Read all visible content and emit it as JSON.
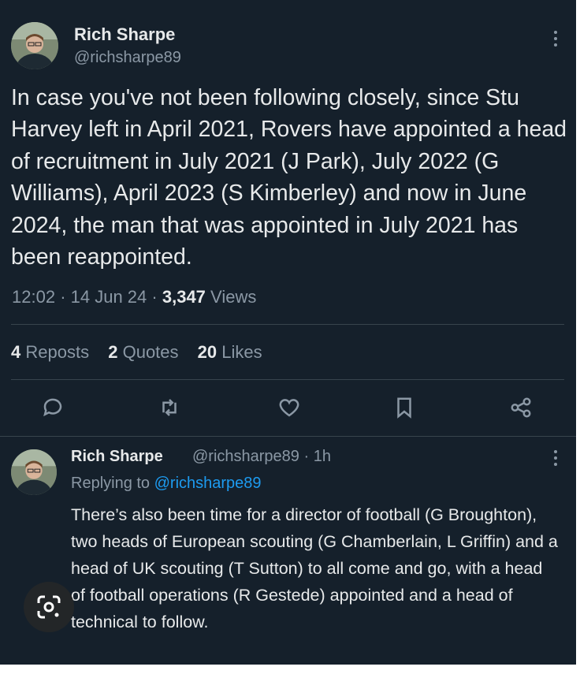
{
  "tweet": {
    "author_name": "Rich Sharpe",
    "author_handle": "@richsharpe89",
    "text": "In case you've not been following closely, since Stu Harvey left in April 2021, Rovers have appointed a head of recruitment in July 2021 (J Park), July 2022 (G Williams), April 2023 (S Kimberley) and now in June 2024, the man that was appointed in July 2021 has been reappointed.",
    "time": "12:02",
    "date": "14 Jun 24",
    "views_count": "3,347",
    "views_label": "Views",
    "reposts_count": "4",
    "reposts_label": "Reposts",
    "quotes_count": "2",
    "quotes_label": "Quotes",
    "likes_count": "20",
    "likes_label": "Likes"
  },
  "actions": {
    "icons": [
      "reply-icon",
      "repost-icon",
      "like-icon",
      "bookmark-icon",
      "share-icon"
    ]
  },
  "reply": {
    "author_name": "Rich Sharpe",
    "author_handle": "@richsharpe89",
    "age": "1h",
    "replying_prefix": "Replying to",
    "replying_to": "@richsharpe89",
    "text": "There’s also been time for a director of football (G Broughton), two heads of European scouting (G Chamberlain, L Griffin) and a head of UK scouting (T Sutton) to all come and go, with a head of football operations (R Gestede) appointed and a head of technical to follow."
  },
  "overlay": {
    "icon": "lens-search-icon"
  },
  "colors": {
    "background": "#15202b",
    "text": "#e7e9ea",
    "muted": "#8b98a5",
    "link": "#1d9bf0",
    "divider": "#38444d"
  }
}
